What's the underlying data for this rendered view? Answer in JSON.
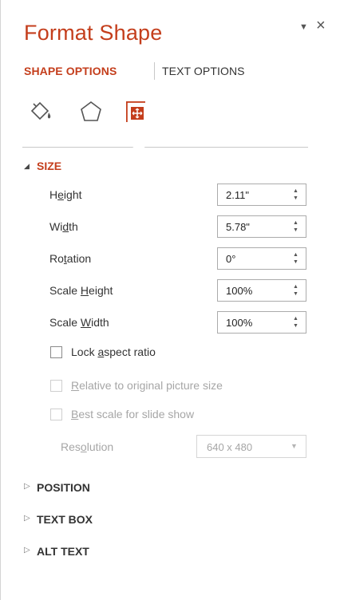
{
  "pane": {
    "title": "Format Shape",
    "menu_glyph": "▼",
    "close_glyph": "×"
  },
  "tabs": [
    {
      "label": "SHAPE OPTIONS",
      "active": true
    },
    {
      "label": "TEXT OPTIONS",
      "active": false
    }
  ],
  "category_icons": [
    "fill-line-icon",
    "effects-icon",
    "size-properties-icon"
  ],
  "colors": {
    "accent": "#c43e1c",
    "text": "#333333",
    "disabled": "#a6a6a6",
    "border": "#ababab"
  },
  "sections": {
    "size": {
      "label": "SIZE",
      "arrow": "◢",
      "fields": [
        {
          "label_pre": "H",
          "label_access": "e",
          "label_post": "ight",
          "value": "2.11\""
        },
        {
          "label_pre": "Wi",
          "label_access": "d",
          "label_post": "th",
          "value": "5.78\""
        },
        {
          "label_pre": "Ro",
          "label_access": "t",
          "label_post": "ation",
          "value": "0°"
        },
        {
          "label_pre": "Scale ",
          "label_access": "H",
          "label_post": "eight",
          "value": "100%"
        },
        {
          "label_pre": "Scale ",
          "label_access": "W",
          "label_post": "idth",
          "value": "100%"
        }
      ],
      "checkboxes": [
        {
          "label_pre": "Lock ",
          "label_access": "a",
          "label_post": "spect ratio",
          "checked": false,
          "enabled": true
        },
        {
          "label_pre": "",
          "label_access": "R",
          "label_post": "elative to original picture size",
          "checked": false,
          "enabled": false
        },
        {
          "label_pre": "",
          "label_access": "B",
          "label_post": "est scale for slide show",
          "checked": false,
          "enabled": false
        }
      ],
      "resolution": {
        "label_pre": "Res",
        "label_access": "o",
        "label_post": "lution",
        "value": "640 x 480",
        "arrow": "▼"
      }
    },
    "position": {
      "label": "POSITION",
      "arrow": "▷"
    },
    "text_box": {
      "label": "TEXT BOX",
      "arrow": "▷"
    },
    "alt_text": {
      "label": "ALT TEXT",
      "arrow": "▷"
    }
  },
  "spinner": {
    "up": "▲",
    "down": "▼"
  }
}
